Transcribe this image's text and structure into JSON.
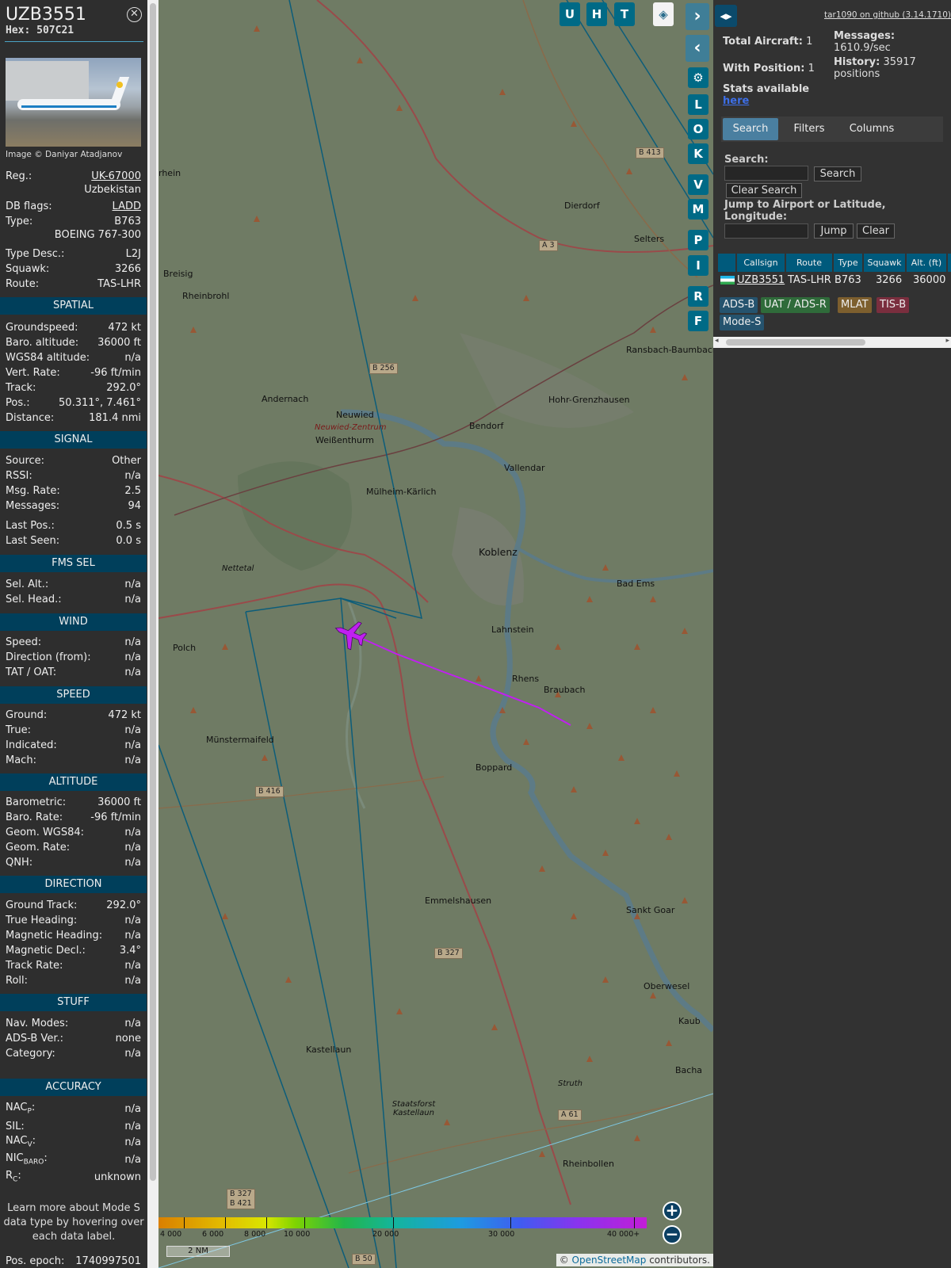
{
  "aircraft": {
    "callsign": "UZB3551",
    "hex": "Hex: 507C21",
    "photo_credit": "Image © Daniyar Atadjanov",
    "fields": [
      {
        "label": "Reg.:",
        "value": "UK-67000",
        "link": true
      },
      {
        "value": "Uzbekistan"
      },
      {
        "label": "DB flags:",
        "value": "LADD",
        "link": true
      },
      {
        "label": "Type:",
        "value": "B763"
      },
      {
        "value": "BOEING 767-300"
      },
      {
        "label": "Type Desc.:",
        "value": "L2J"
      },
      {
        "label": "Squawk:",
        "value": "3266"
      },
      {
        "label": "Route:",
        "value": "TAS-LHR"
      }
    ]
  },
  "sections": [
    {
      "title": "SPATIAL",
      "rows": [
        {
          "label": "Groundspeed:",
          "value": "472 kt"
        },
        {
          "label": "Baro. altitude:",
          "value": "36000 ft"
        },
        {
          "label": "WGS84 altitude:",
          "value": "n/a"
        },
        {
          "label": "Vert. Rate:",
          "value": "-96 ft/min"
        },
        {
          "label": "Track:",
          "value": "292.0°"
        },
        {
          "label": "Pos.:",
          "value": "50.311°, 7.461°"
        },
        {
          "label": "Distance:",
          "value": "181.4 nmi"
        }
      ]
    },
    {
      "title": "SIGNAL",
      "rows": [
        {
          "label": "Source:",
          "value": "Other"
        },
        {
          "label": "RSSI:",
          "value": "n/a"
        },
        {
          "label": "Msg. Rate:",
          "value": "2.5"
        },
        {
          "label": "Messages:",
          "value": "94"
        },
        {
          "label": "Last Pos.:",
          "value": "0.5 s"
        },
        {
          "label": "Last Seen:",
          "value": "0.0 s"
        }
      ]
    },
    {
      "title": "FMS SEL",
      "rows": [
        {
          "label": "Sel. Alt.:",
          "value": "n/a"
        },
        {
          "label": "Sel. Head.:",
          "value": "n/a"
        }
      ]
    },
    {
      "title": "WIND",
      "rows": [
        {
          "label": "Speed:",
          "value": "n/a"
        },
        {
          "label": "Direction (from):",
          "value": "n/a"
        },
        {
          "label": "TAT / OAT:",
          "value": "n/a"
        }
      ]
    },
    {
      "title": "SPEED",
      "rows": [
        {
          "label": "Ground:",
          "value": "472 kt"
        },
        {
          "label": "True:",
          "value": "n/a"
        },
        {
          "label": "Indicated:",
          "value": "n/a"
        },
        {
          "label": "Mach:",
          "value": "n/a"
        }
      ]
    },
    {
      "title": "ALTITUDE",
      "rows": [
        {
          "label": "Barometric:",
          "value": "36000 ft"
        },
        {
          "label": "Baro. Rate:",
          "value": "-96 ft/min"
        },
        {
          "label": "Geom. WGS84:",
          "value": "n/a"
        },
        {
          "label": "Geom. Rate:",
          "value": "n/a"
        },
        {
          "label": "QNH:",
          "value": "n/a"
        }
      ]
    },
    {
      "title": "DIRECTION",
      "rows": [
        {
          "label": "Ground Track:",
          "value": "292.0°"
        },
        {
          "label": "True Heading:",
          "value": "n/a"
        },
        {
          "label": "Magnetic Heading:",
          "value": "n/a"
        },
        {
          "label": "Magnetic Decl.:",
          "value": "3.4°"
        },
        {
          "label": "Track Rate:",
          "value": "n/a"
        },
        {
          "label": "Roll:",
          "value": "n/a"
        }
      ]
    },
    {
      "title": "STUFF",
      "rows": [
        {
          "label": "Nav. Modes:",
          "value": "n/a"
        },
        {
          "label": "ADS-B Ver.:",
          "value": "none"
        },
        {
          "label": "Category:",
          "value": "n/a"
        }
      ]
    },
    {
      "title": "ACCURACY",
      "rows": [
        {
          "label": "NAC",
          "sub": "P",
          "suffix": ":",
          "value": "n/a"
        },
        {
          "label": "SIL:",
          "value": "n/a"
        },
        {
          "label": "NAC",
          "sub": "V",
          "suffix": ":",
          "value": "n/a"
        },
        {
          "label": "NIC",
          "sub": "BARO",
          "suffix": ":",
          "value": "n/a"
        },
        {
          "label": "R",
          "sub": "C",
          "suffix": ":",
          "value": "unknown"
        }
      ]
    }
  ],
  "hint": "Learn more about Mode S data type by hovering over each data label.",
  "pos_epoch": {
    "label": "Pos. epoch:",
    "value": "1740997501"
  },
  "map": {
    "buttons_top": [
      "U",
      "H",
      "T"
    ],
    "buttons_side": [
      "L",
      "O",
      "K",
      "V",
      "M",
      "P",
      "I",
      "R",
      "F"
    ],
    "labels": [
      "Rheinbrohl",
      "Andernach",
      "Neuwied",
      "Neuwied-Zentrum",
      "Weißenthurm",
      "Bendorf",
      "Vallendar",
      "Mülheim-Kärlich",
      "Koblenz",
      "Lahnstein",
      "Bad Ems",
      "Polch",
      "Rhens",
      "Braubach",
      "Münstermaifeld",
      "Boppard",
      "Emmelshausen",
      "Sankt Goar",
      "Oberwesel",
      "Kastellaun",
      "Staatsforst Kastellaun",
      "Rheinbollen",
      "Dierdorf",
      "Selters",
      "Hohr-Grenzhausen",
      "Ransbach-Baumbach",
      "Nettetal",
      "Struth",
      "Breisig",
      "rhein",
      "Kaub",
      "Bacha"
    ],
    "road_tags": [
      "B 413",
      "A 3",
      "B 256",
      "B 416",
      "B 327",
      "A 61",
      "B 327\nB 421",
      "B 50"
    ],
    "colorbar_labels": [
      "4 000",
      "6 000",
      "8 000",
      "10 000",
      "20 000",
      "30 000",
      "40 000+"
    ],
    "scale": "2 NM",
    "attribution_prefix": "© ",
    "attribution_link": "OpenStreetMap",
    "attribution_suffix": " contributors.",
    "track_color": "#c020f0",
    "aircraft_color": "#c020f0"
  },
  "panel": {
    "github": "tar1090 on github (3.14.1710)",
    "total_aircraft_label": "Total Aircraft:",
    "total_aircraft": "1",
    "with_position_label": "With Position:",
    "with_position": "1",
    "messages_label": "Messages:",
    "messages": "1610.9/sec",
    "history_label": "History:",
    "history": "35917 positions",
    "stats_label": "Stats available",
    "stats_link": "here",
    "tabs": [
      "Search",
      "Filters",
      "Columns"
    ],
    "search_label": "Search:",
    "search_btn": "Search",
    "clear_search_btn": "Clear Search",
    "jump_label": "Jump to Airport or Latitude, Longitude:",
    "jump_btn": "Jump",
    "clear_btn": "Clear",
    "table_headers": [
      "Callsign",
      "Route",
      "Type",
      "Squawk",
      "Alt. (ft)"
    ],
    "table_row": {
      "callsign": "UZB3551",
      "route": "TAS-LHR",
      "type": "B763",
      "squawk": "3266",
      "alt": "36000"
    },
    "badges": [
      "ADS-B",
      "UAT / ADS-R",
      "MLAT",
      "TIS-B",
      "Mode-S"
    ]
  }
}
